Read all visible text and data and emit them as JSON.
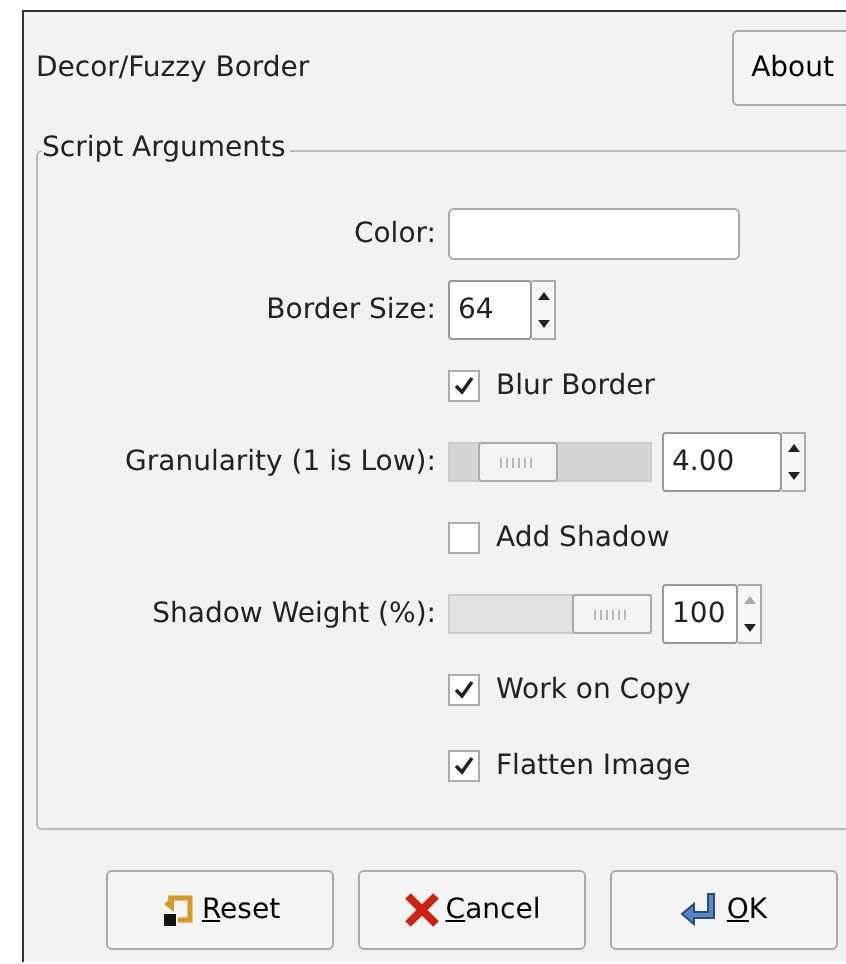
{
  "header": {
    "title": "Decor/Fuzzy Border",
    "about_button": "About"
  },
  "frame": {
    "title": "Script Arguments",
    "rows": [
      {
        "kind": "color",
        "label": "Color:"
      },
      {
        "kind": "spin",
        "label": "Border Size:",
        "value": "64"
      },
      {
        "kind": "check",
        "label": "Blur Border",
        "checked": true
      },
      {
        "kind": "slider",
        "label": "Granularity (1 is Low):",
        "value": "4.00",
        "level": 0.23,
        "disabled": false
      },
      {
        "kind": "check",
        "label": "Add Shadow",
        "checked": false
      },
      {
        "kind": "slider",
        "label": "Shadow Weight (%):",
        "value": "100",
        "level": 1,
        "disabled": true
      },
      {
        "kind": "check",
        "label": "Work on Copy",
        "checked": true
      },
      {
        "kind": "check",
        "label": "Flatten Image",
        "checked": true
      }
    ]
  },
  "buttons": [
    {
      "kind": "reset",
      "label": "Reset"
    },
    {
      "kind": "cancel",
      "label": "Cancel"
    },
    {
      "kind": "ok",
      "label": "OK"
    }
  ]
}
